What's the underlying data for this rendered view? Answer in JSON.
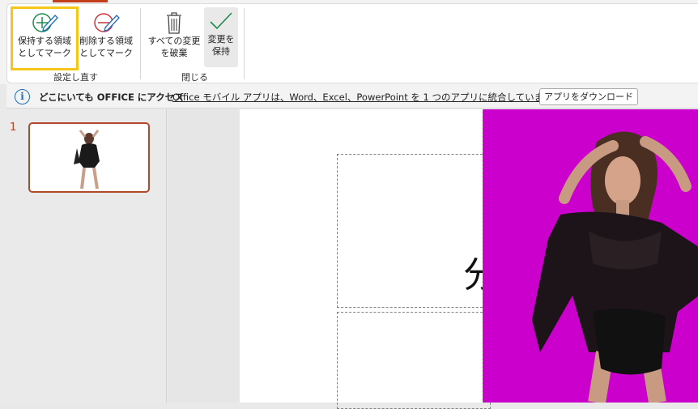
{
  "ribbon": {
    "keep_button": {
      "line1": "保持する領域",
      "line2": "としてマーク"
    },
    "remove_button": {
      "line1": "削除する領域",
      "line2": "としてマーク"
    },
    "discard_button": {
      "line1": "すべての変更",
      "line2": "を破棄"
    },
    "save_button": {
      "line1": "変更を",
      "line2": "保持"
    },
    "group_refine": "設定し直す",
    "group_close": "閉じる"
  },
  "infobar": {
    "title": "どこにいても OFFICE にアクセス",
    "message": "Office モバイル アプリは、Word、Excel、PowerPoint を 1 つのアプリに統合しています。",
    "button": "アプリをダウンロード"
  },
  "thumbnails": {
    "slide_number": "1"
  },
  "slide": {
    "title_fragment": "分"
  },
  "colors": {
    "accent": "#c43e1c",
    "highlight": "#f5c518",
    "photo_bg": "#cc00cc",
    "info_blue": "#1b6ec2"
  }
}
